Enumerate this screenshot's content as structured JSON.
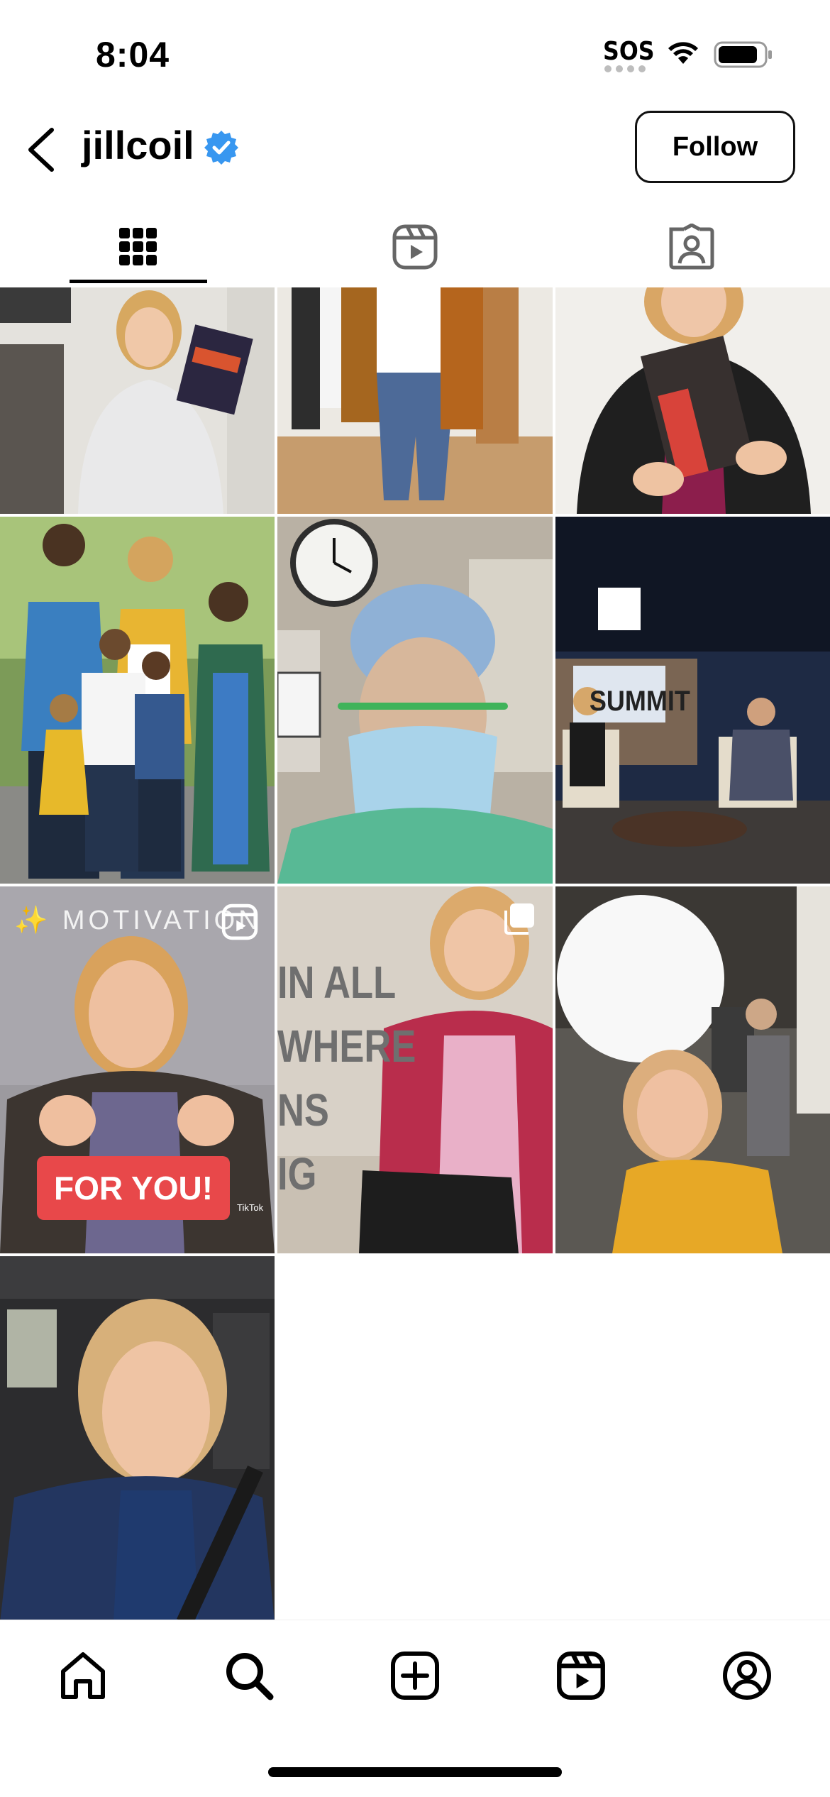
{
  "status_bar": {
    "time": "8:04",
    "sos": "SOS",
    "icons": [
      "wifi-icon",
      "battery-icon"
    ]
  },
  "header": {
    "username": "jillcoil",
    "verified": true,
    "follow_label": "Follow",
    "back_icon": "chevron-left-icon"
  },
  "tabs": [
    {
      "name": "posts",
      "icon": "grid-icon",
      "active": true
    },
    {
      "name": "reels",
      "icon": "reels-icon",
      "active": false
    },
    {
      "name": "tagged",
      "icon": "tagged-person-icon",
      "active": false
    }
  ],
  "posts": [
    {
      "overlay": ""
    },
    {
      "overlay": ""
    },
    {
      "overlay": ""
    },
    {
      "overlay": ""
    },
    {
      "overlay": ""
    },
    {
      "overlay": "SUMMIT"
    },
    {
      "overlay": "✨ MOTIVATION",
      "sticker": "FOR YOU!",
      "watermark": "TikTok",
      "reel": true
    },
    {
      "overlay": "IN ALL\nWHERE\nNS\nIG",
      "multi": true
    },
    {
      "overlay": ""
    },
    {
      "overlay": ""
    }
  ],
  "bottom_nav": [
    {
      "name": "home",
      "icon": "home-icon"
    },
    {
      "name": "search",
      "icon": "search-icon"
    },
    {
      "name": "create",
      "icon": "plus-square-icon"
    },
    {
      "name": "reels",
      "icon": "reels-icon"
    },
    {
      "name": "profile",
      "icon": "profile-icon"
    }
  ],
  "colors": {
    "accent": "#3897f0",
    "text": "#000000",
    "background": "#ffffff",
    "sticker": "#e8484a"
  }
}
